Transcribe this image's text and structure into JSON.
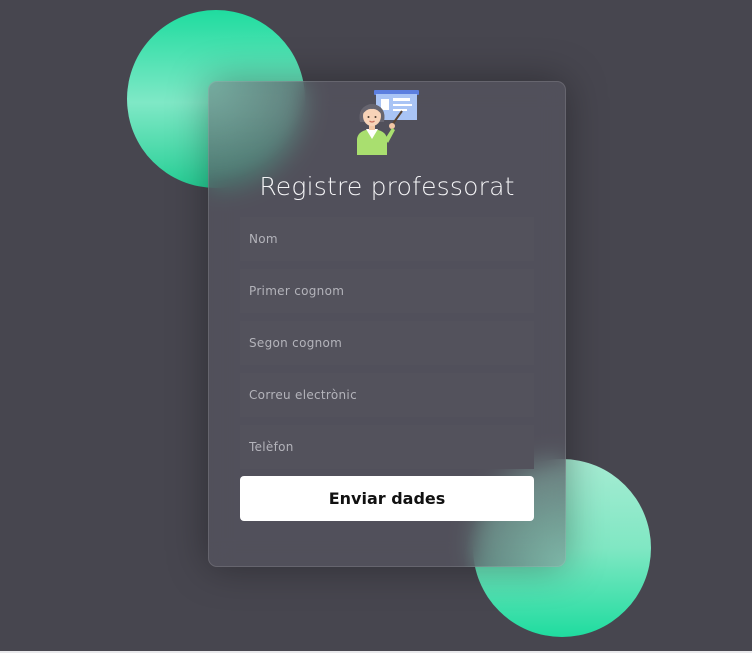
{
  "form": {
    "title": "Registre professorat",
    "fields": [
      {
        "name": "nom",
        "placeholder": "Nom"
      },
      {
        "name": "primer-cognom",
        "placeholder": "Primer cognom"
      },
      {
        "name": "segon-cognom",
        "placeholder": "Segon cognom"
      },
      {
        "name": "correu",
        "placeholder": "Correu electrònic"
      },
      {
        "name": "telefon",
        "placeholder": "Telèfon"
      }
    ],
    "submit_label": "Enviar dades"
  },
  "icons": {
    "logo": "teacher-at-board-icon"
  },
  "colors": {
    "background": "#47464f",
    "accent": "#1fdc9f",
    "card": "#56555f",
    "field": "#53525c",
    "button": "#ffffff"
  }
}
